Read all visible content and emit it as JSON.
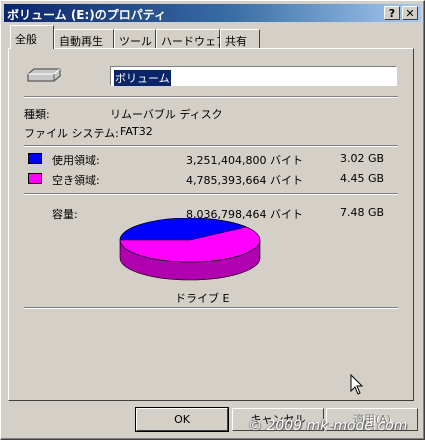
{
  "window": {
    "title": "ボリューム (E:)のプロパティ",
    "help_btn": "?",
    "close_btn": "✕"
  },
  "tabs": [
    "全般",
    "自動再生",
    "ツール",
    "ハードウェア",
    "共有"
  ],
  "volume": {
    "name": "ボリューム"
  },
  "type": {
    "label": "種類:",
    "value": "リムーバブル ディスク"
  },
  "fs": {
    "label": "ファイル システム:",
    "value": "FAT32"
  },
  "used": {
    "label": "使用領域:",
    "bytes": "3,251,404,800 バイト",
    "size": "3.02 GB",
    "color": "#0000ff"
  },
  "free": {
    "label": "空き領域:",
    "bytes": "4,785,393,664 バイト",
    "size": "4.45 GB",
    "color": "#ff00ff"
  },
  "capacity": {
    "label": "容量:",
    "bytes": "8,036,798,464 バイト",
    "size": "7.48 GB"
  },
  "drive_label": "ドライブ E",
  "buttons": {
    "ok": "OK",
    "cancel": "キャンセル",
    "apply": "適用(A)"
  },
  "watermark": "© 2009 mk-mode.com"
}
